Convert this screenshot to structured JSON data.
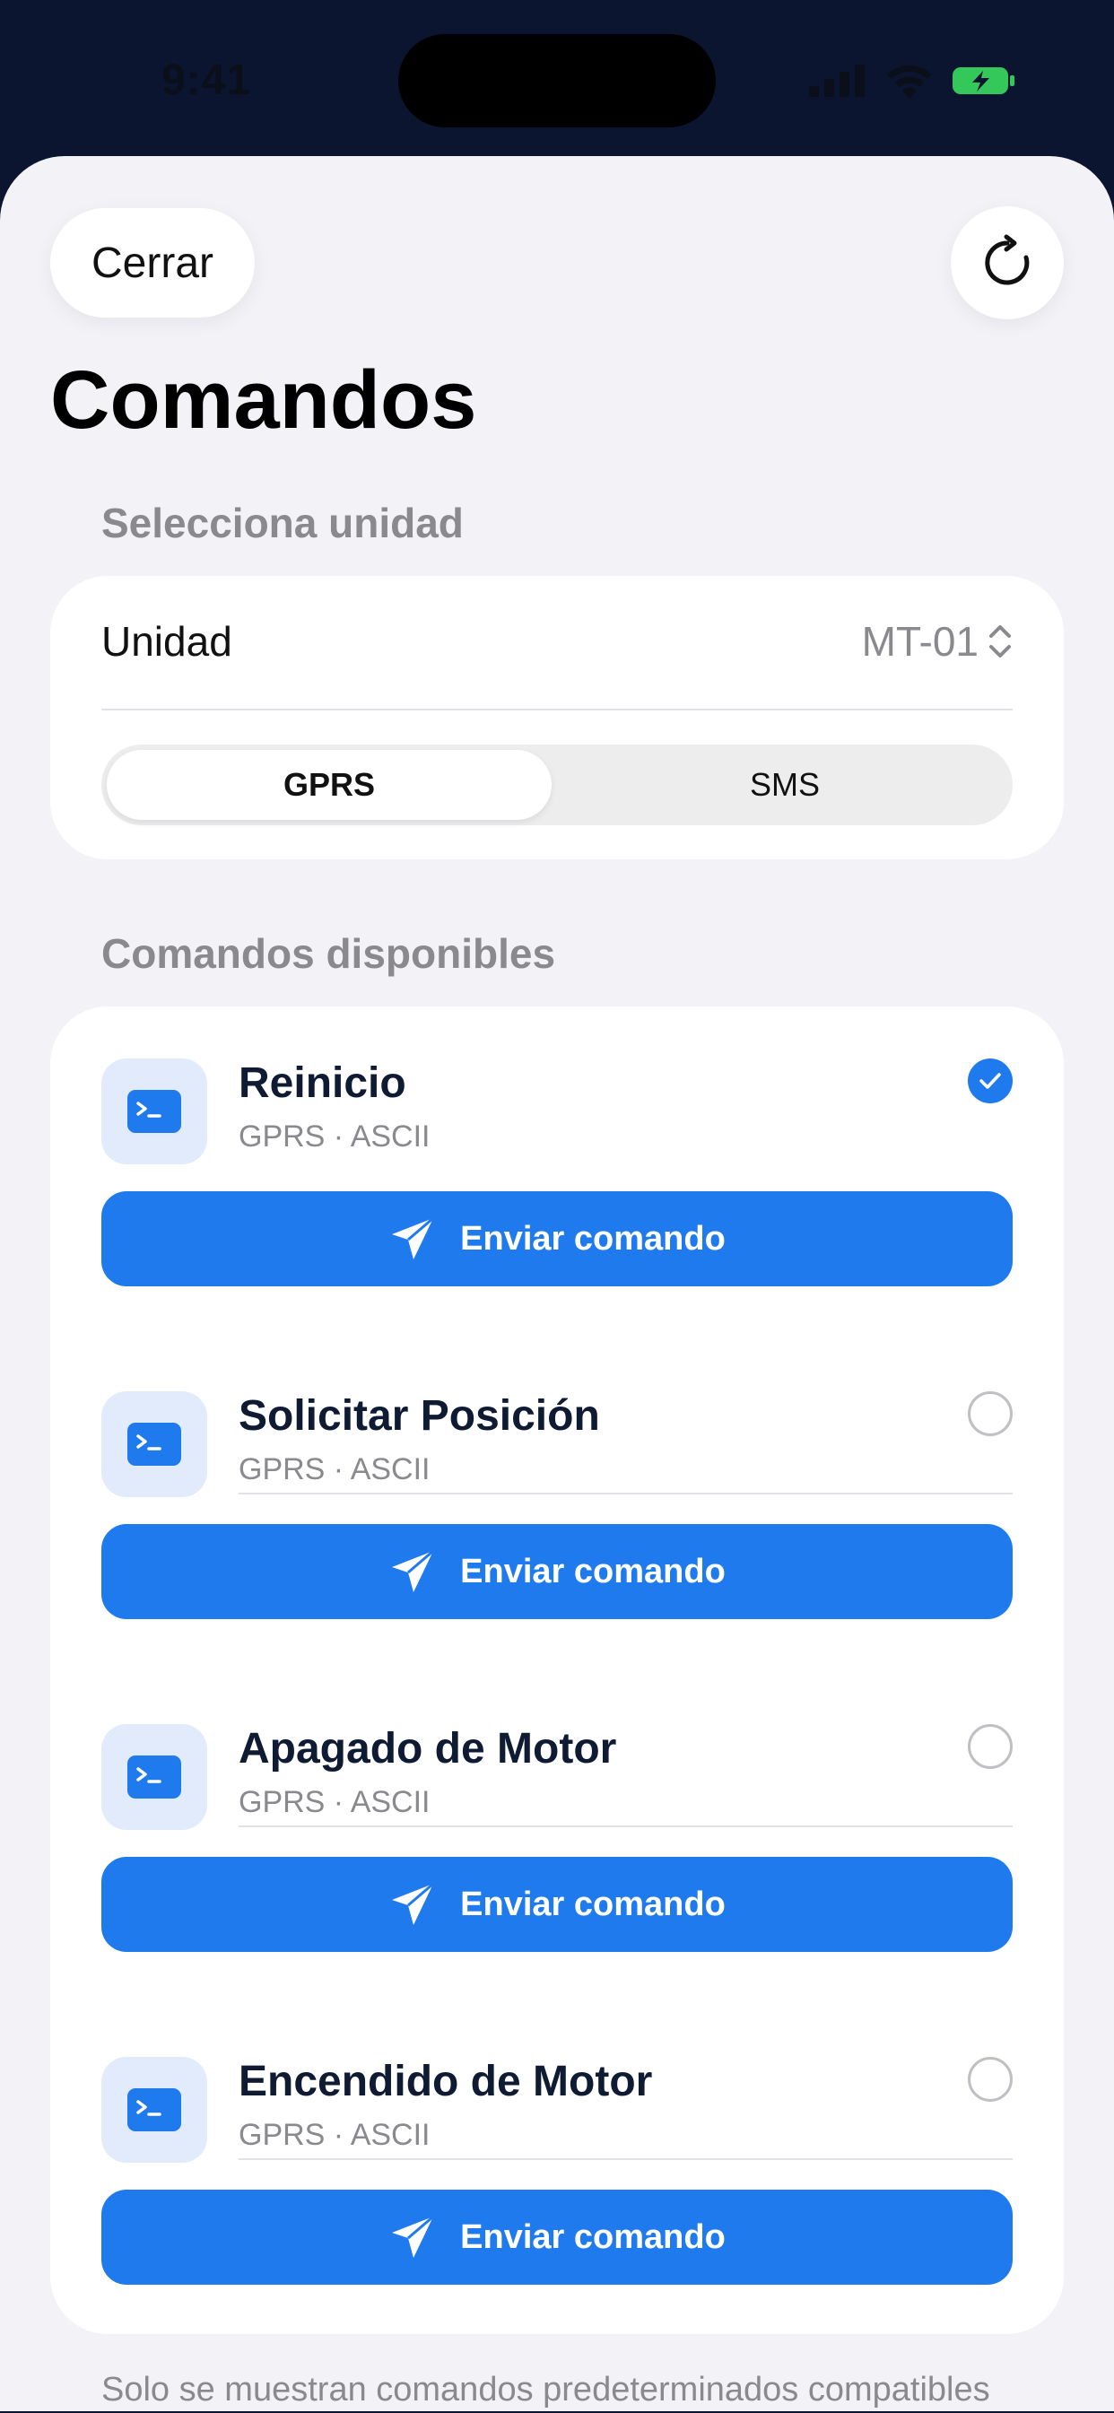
{
  "status_bar": {
    "time": "9:41"
  },
  "header": {
    "close_label": "Cerrar",
    "title": "Comandos"
  },
  "unit_section": {
    "label": "Selecciona unidad",
    "field_label": "Unidad",
    "field_value": "MT-01",
    "segments": [
      {
        "label": "GPRS",
        "selected": true
      },
      {
        "label": "SMS",
        "selected": false
      }
    ]
  },
  "commands_section": {
    "label": "Comandos disponibles",
    "send_label": "Enviar comando",
    "items": [
      {
        "name": "Reinicio",
        "subtitle": "GPRS · ASCII",
        "selected": true
      },
      {
        "name": "Solicitar Posición",
        "subtitle": "GPRS · ASCII",
        "selected": false
      },
      {
        "name": "Apagado de Motor",
        "subtitle": "GPRS · ASCII",
        "selected": false
      },
      {
        "name": "Encendido de Motor",
        "subtitle": "GPRS · ASCII",
        "selected": false
      }
    ]
  },
  "footer": {
    "note": "Solo se muestran comandos predeterminados compatibles"
  },
  "colors": {
    "accent": "#1f7bed",
    "battery": "#34c759",
    "background": "#f2f2f7",
    "top_background": "#0b1530"
  }
}
